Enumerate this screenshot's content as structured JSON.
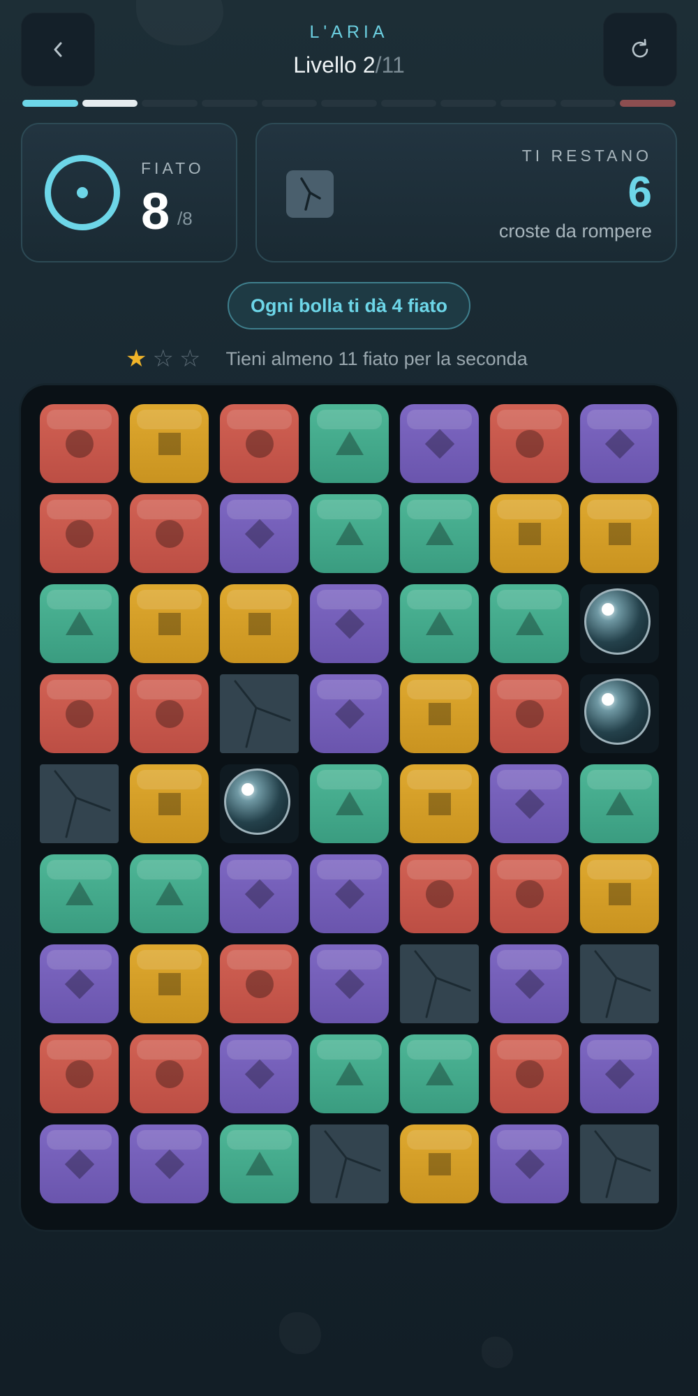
{
  "header": {
    "world": "L'ARIA",
    "level_label": "Livello 2",
    "level_total": "/11",
    "back_icon": "chevron-left-icon",
    "restart_icon": "restart-icon"
  },
  "progress": {
    "total_levels": 11,
    "completed": 1,
    "current": 2
  },
  "breath": {
    "label": "FIATO",
    "value": "8",
    "max": "/8"
  },
  "remaining": {
    "label": "TI RESTANO",
    "value": "6",
    "subtitle": "croste da rompere"
  },
  "hint": "Ogni bolla ti dà 4 fiato",
  "stars": {
    "earned": 1,
    "total": 3,
    "goal_text": "Tieni almeno 11 fiato per la seconda"
  },
  "colors": {
    "accent": "#6dd6e8",
    "star": "#f0b429",
    "red": "#c9584c",
    "yellow": "#d69f28",
    "green": "#45ab8b",
    "purple": "#745fb9",
    "crust": "#33444f"
  },
  "board": {
    "cols": 7,
    "rows": 9,
    "cells": [
      [
        "red",
        "yellow",
        "red",
        "green",
        "purple",
        "red",
        "purple"
      ],
      [
        "red",
        "red",
        "purple",
        "green",
        "green",
        "yellow",
        "yellow"
      ],
      [
        "green",
        "yellow",
        "yellow",
        "purple",
        "green",
        "green",
        "bubble"
      ],
      [
        "red",
        "red",
        "crust",
        "purple",
        "yellow",
        "red",
        "bubble"
      ],
      [
        "crust",
        "yellow",
        "bubble",
        "green",
        "yellow",
        "purple",
        "green"
      ],
      [
        "green",
        "green",
        "purple",
        "purple",
        "red",
        "red",
        "yellow"
      ],
      [
        "purple",
        "yellow",
        "red",
        "purple",
        "crust",
        "purple",
        "crust"
      ],
      [
        "red",
        "red",
        "purple",
        "green",
        "green",
        "red",
        "purple"
      ],
      [
        "purple",
        "purple",
        "green",
        "crust",
        "yellow",
        "purple",
        "crust"
      ]
    ]
  }
}
